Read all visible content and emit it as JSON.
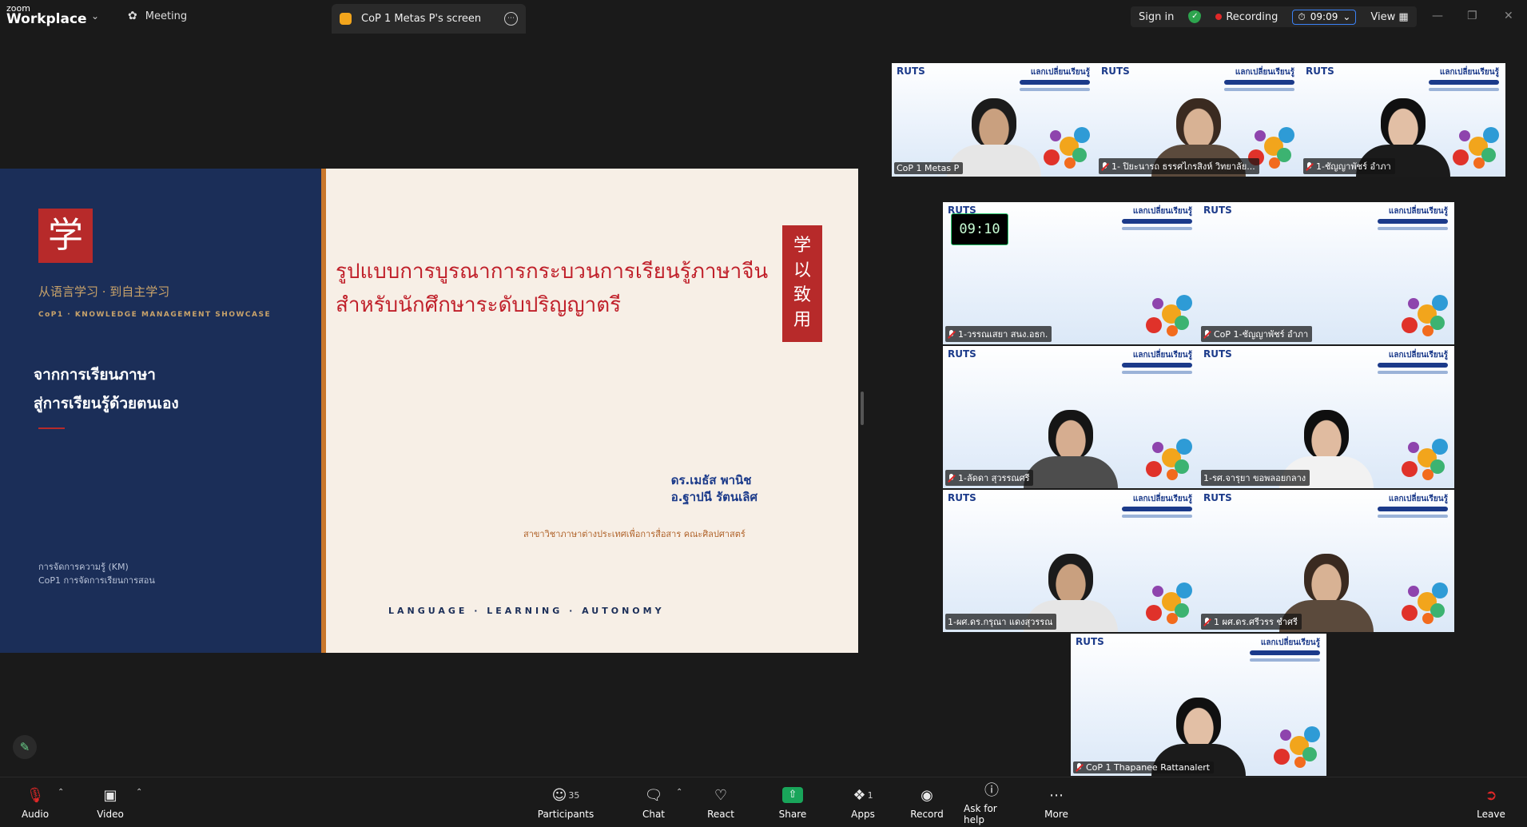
{
  "app": {
    "logo_small": "zoom",
    "logo_big": "Workplace"
  },
  "tabs": {
    "meeting": "Meeting",
    "screen": "CoP 1 Metas P's screen"
  },
  "status": {
    "sign_in": "Sign in",
    "recording": "Recording",
    "timer": "09:09",
    "view": "View"
  },
  "slide": {
    "chinese_sub": "从语言学习 · 到自主学习",
    "showcase": "CoP1 · KNOWLEDGE MANAGEMENT SHOWCASE",
    "left_title_1": "จากการเรียนภาษา",
    "left_title_2": "สู่การเรียนรู้ด้วยตนเอง",
    "km_line_1": "การจัดการความรู้ (KM)",
    "km_line_2": "CoP1 การจัดการเรียนการสอน",
    "title_1": "รูปแบบการบูรณาการกระบวนการเรียนรู้ภาษาจีน",
    "title_2": "สำหรับนักศึกษาระดับปริญญาตรี",
    "vertical_chars": [
      "学",
      "以",
      "致",
      "用"
    ],
    "author_1": "ดร.เมธัส พานิช",
    "author_2": "อ.ฐาปนี รัตนเลิศ",
    "department": "สาขาวิชาภาษาต่างประเทศเพื่อการสื่อสาร  คณะศิลปศาสตร์",
    "footer": "LANGUAGE · LEARNING · AUTONOMY"
  },
  "participants_top": [
    {
      "name": "CoP 1 Metas P",
      "muted": false
    },
    {
      "name": "1- ปิยะนารถ ธรรศไกรสิงห์ วิทยาลัย...",
      "muted": true
    },
    {
      "name": "1-ชัญญาพัชร์ อำภา",
      "muted": true
    }
  ],
  "participants_grid": [
    {
      "name": "1-วรรณเสยา  สนง.อธก.",
      "muted": true
    },
    {
      "name": "CoP 1-ชัญญาพัชร์ อำภา",
      "muted": true
    },
    {
      "name": "1-ลัดดา สุวรรณศรี",
      "muted": true
    },
    {
      "name": "1-รศ.จารุยา ขอพลอยกลาง",
      "muted": false
    },
    {
      "name": "1-ผศ.ดร.กรุณา แดงสุวรรณ",
      "muted": false
    },
    {
      "name": "1 ผศ.ดร.ศรีวรร ชำศรี",
      "muted": true
    },
    {
      "name": "CoP 1 Thapanee Rattanalert",
      "muted": true
    }
  ],
  "tile_ruts": "RUTS",
  "tile_banner": "แลกเปลี่ยนเรียนรู้",
  "grid_timer": "09:10",
  "toolbar": {
    "audio": "Audio",
    "video": "Video",
    "participants": "Participants",
    "participants_count": "35",
    "chat": "Chat",
    "react": "React",
    "share": "Share",
    "apps": "Apps",
    "apps_count": "1",
    "record": "Record",
    "help": "Ask for help",
    "more": "More",
    "leave": "Leave"
  },
  "colors": {
    "accent_green": "#2ecc71",
    "record_red": "#e02828",
    "slide_navy": "#1b2e58",
    "slide_red": "#b72a2a"
  }
}
